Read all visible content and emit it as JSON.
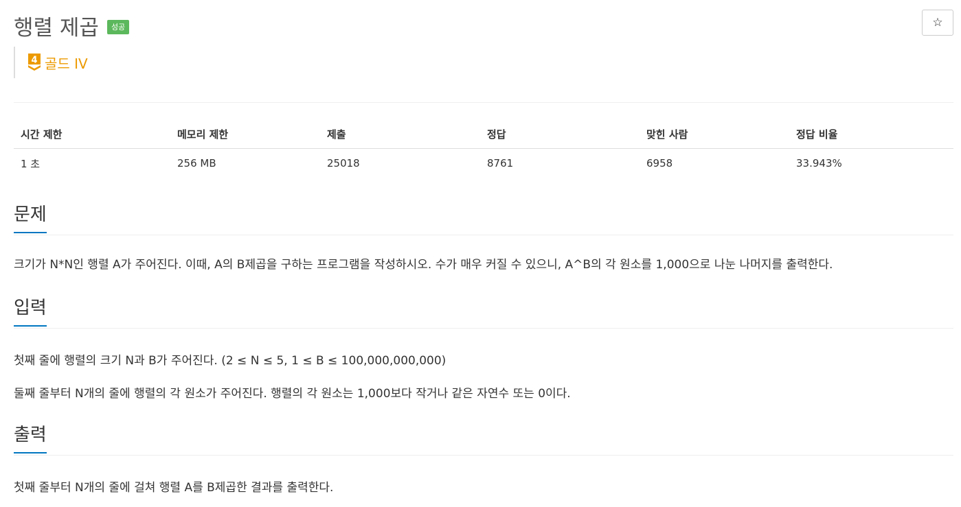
{
  "problem": {
    "title": "행렬 제곱",
    "status": "성공",
    "tier_number": "4",
    "tier_label": "골드 IV",
    "star": "☆"
  },
  "stats": {
    "headers": [
      "시간 제한",
      "메모리 제한",
      "제출",
      "정답",
      "맞힌 사람",
      "정답 비율"
    ],
    "values": [
      "1 초",
      "256 MB",
      "25018",
      "8761",
      "6958",
      "33.943%"
    ]
  },
  "sections": {
    "problem": {
      "title": "문제",
      "body": "크기가 N*N인 행렬 A가 주어진다. 이때, A의 B제곱을 구하는 프로그램을 작성하시오. 수가 매우 커질 수 있으니, A^B의 각 원소를 1,000으로 나눈 나머지를 출력한다."
    },
    "input": {
      "title": "입력",
      "line1": "첫째 줄에 행렬의 크기 N과 B가 주어진다. (2 ≤ N ≤  5, 1 ≤ B ≤ 100,000,000,000)",
      "line2": "둘째 줄부터 N개의 줄에 행렬의 각 원소가 주어진다. 행렬의 각 원소는 1,000보다 작거나 같은 자연수 또는 0이다."
    },
    "output": {
      "title": "출력",
      "body": "첫째 줄부터 N개의 줄에 걸쳐 행렬 A를 B제곱한 결과를 출력한다."
    }
  },
  "colors": {
    "accent": "#0076c0",
    "success": "#5cb85c",
    "gold": "#ec9a00"
  }
}
